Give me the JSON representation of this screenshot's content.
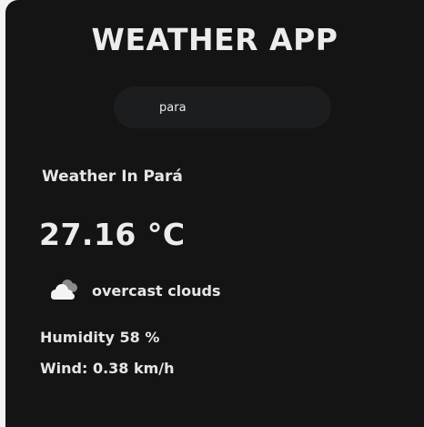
{
  "app": {
    "title": "WEATHER APP"
  },
  "search": {
    "value": "para"
  },
  "weather": {
    "location": "Weather In Pará",
    "temperature": "27.16 °C",
    "condition": "overcast clouds",
    "condition_icon": "overcast-clouds-icon",
    "humidity": "Humidity 58 %",
    "wind": "Wind: 0.38 km/h"
  },
  "colors": {
    "background": "#141414",
    "search_bg": "#1c1d1f",
    "text": "#ececec"
  }
}
